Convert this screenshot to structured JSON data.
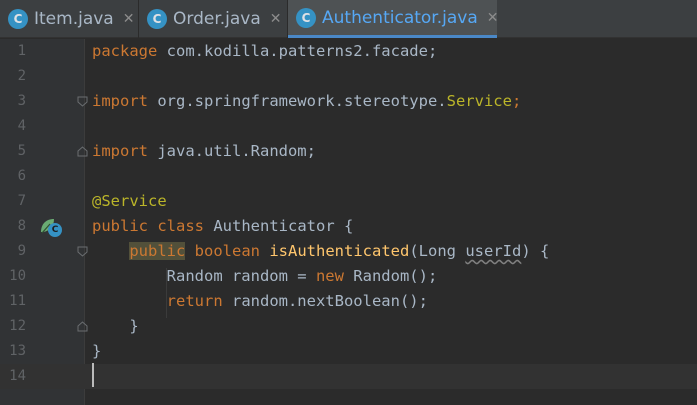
{
  "tabs": [
    {
      "label": "Item.java",
      "icon": "java-class-icon",
      "icon_letter": "C",
      "active": false
    },
    {
      "label": "Order.java",
      "icon": "java-class-icon",
      "icon_letter": "C",
      "active": false
    },
    {
      "label": "Authenticator.java",
      "icon": "java-class-icon",
      "icon_letter": "C",
      "active": true
    }
  ],
  "tab_close_glyph": "✕",
  "gutter": {
    "line_numbers": [
      "1",
      "2",
      "3",
      "4",
      "5",
      "6",
      "7",
      "8",
      "9",
      "10",
      "11",
      "12",
      "13",
      "14"
    ],
    "class_marker_icon": "spring-bean-class-icon",
    "class_marker_letter": "C"
  },
  "editor": {
    "line1": {
      "kw": "package",
      "rest": " com.kodilla.patterns2.facade;"
    },
    "line3": {
      "kw": "import",
      "pkg": " org.springframework.stereotype.",
      "cls": "Service",
      "end": ";"
    },
    "line5": {
      "kw": "import",
      "rest": " java.util.Random;"
    },
    "line7": {
      "annotation": "@Service"
    },
    "line8": {
      "kw1": "public",
      "kw2": "class",
      "name": " Authenticator {"
    },
    "line9": {
      "kw1": "public",
      "kw2": "boolean",
      "method": "isAuthenticated",
      "open": "(Long ",
      "param": "userId",
      "close": ") {"
    },
    "line10": {
      "type": "Random random = ",
      "kw": "new",
      "rest": " Random();"
    },
    "line11": {
      "kw": "return",
      "rest": " random.nextBoolean();"
    },
    "line12": {
      "text": "}"
    },
    "line13": {
      "text": "}"
    }
  },
  "colors": {
    "background": "#2b2b2b",
    "keyword": "#cc7832",
    "annotation": "#bbb529",
    "method": "#ffc66d",
    "text": "#a9b7c6",
    "tab_active_accent": "#4a88c7",
    "file_icon": "#3592c4",
    "spring_bean": "#6aab73"
  }
}
